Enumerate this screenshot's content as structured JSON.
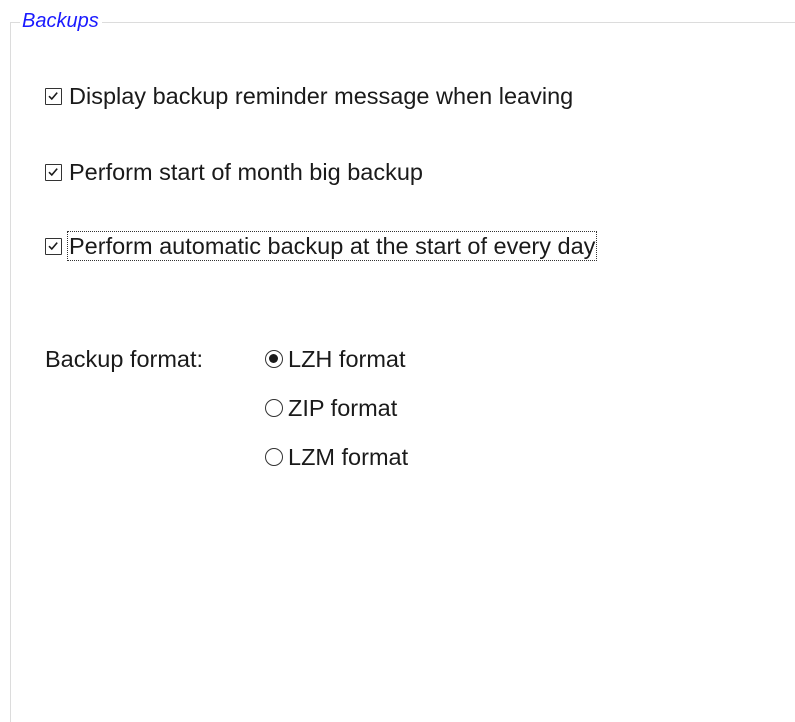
{
  "group": {
    "title": "Backups"
  },
  "options": [
    {
      "label": "Display backup reminder message when leaving",
      "checked": true
    },
    {
      "label": "Perform start of month big backup",
      "checked": true
    },
    {
      "label": "Perform automatic backup at the start of every day",
      "checked": true
    }
  ],
  "backup_format": {
    "label": "Backup format:",
    "selected": "LZH format",
    "choices": [
      {
        "label": "LZH format",
        "selected": true
      },
      {
        "label": "ZIP format",
        "selected": false
      },
      {
        "label": "LZM format",
        "selected": false
      }
    ]
  },
  "colors": {
    "legend_text": "#1a1aff",
    "text": "#1a1a1a",
    "groupbox_border": "#dcdcdc"
  }
}
